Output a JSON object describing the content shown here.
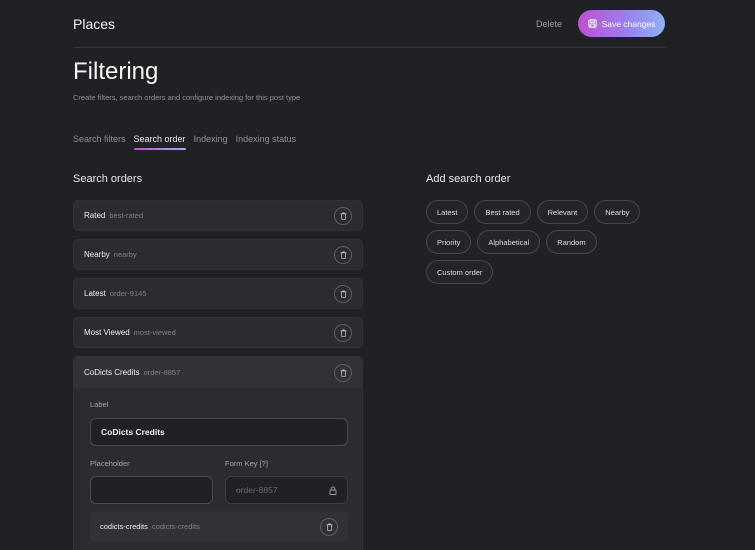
{
  "header": {
    "app_title": "Places",
    "delete_label": "Delete",
    "save_label": "Save changes"
  },
  "page": {
    "title": "Filtering",
    "subtitle": "Create filters, search orders and configure indexing for this post type"
  },
  "tabs": [
    {
      "label": "Search filters",
      "active": false
    },
    {
      "label": "Search order",
      "active": true
    },
    {
      "label": "Indexing",
      "active": false
    },
    {
      "label": "Indexing status",
      "active": false
    }
  ],
  "search_orders": {
    "title": "Search orders",
    "items": [
      {
        "name": "Rated",
        "key": "best-rated"
      },
      {
        "name": "Nearby",
        "key": "nearby"
      },
      {
        "name": "Latest",
        "key": "order-9145"
      },
      {
        "name": "Most Viewed",
        "key": "most-viewed"
      }
    ],
    "expanded": {
      "name": "CoDicts Credits",
      "key": "order-8857",
      "label_field_label": "Label",
      "label_value": "CoDicts Credits",
      "placeholder_field_label": "Placeholder",
      "placeholder_value": "",
      "form_key_label": "Form Key [?]",
      "form_key_value": "order-8857",
      "sub_item": {
        "name": "codicts-credits",
        "key": "codicts-credits"
      }
    }
  },
  "add_search_order": {
    "title": "Add search order",
    "options": [
      "Latest",
      "Best rated",
      "Relevant",
      "Nearby",
      "Priority",
      "Alphabetical",
      "Random",
      "Custom order"
    ]
  },
  "colors": {
    "background": "#1f2124",
    "panel": "#2a2c30",
    "accent_gradient_start": "#c04fd0",
    "accent_gradient_end": "#8fb0f5"
  },
  "icons": {
    "save": "save-icon",
    "trash": "trash-icon",
    "lock": "lock-icon"
  }
}
